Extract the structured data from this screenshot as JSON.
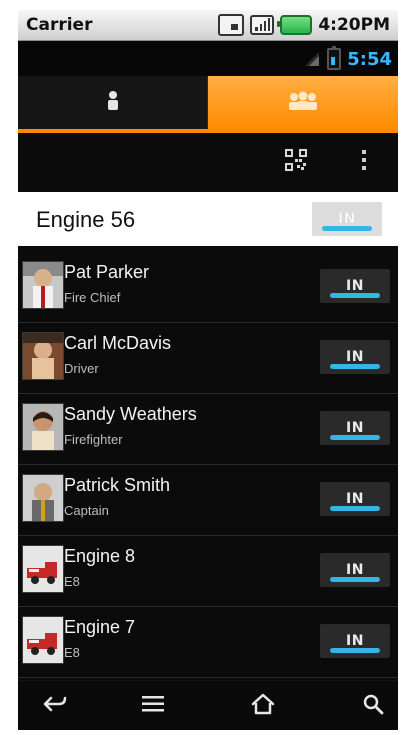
{
  "status_bar": {
    "carrier": "Carrier",
    "time": "4:20PM"
  },
  "android_status": {
    "time": "5:54",
    "accent": "#39b6ff"
  },
  "tabs": [
    {
      "name": "person-tab",
      "selected": false
    },
    {
      "name": "group-tab",
      "selected": true
    }
  ],
  "header_card": {
    "title": "Engine 56",
    "button_label": "IN"
  },
  "members": [
    {
      "name": "Pat Parker",
      "role": "Fire Chief",
      "avatar": "person",
      "status": "IN"
    },
    {
      "name": "Carl McDavis",
      "role": "Driver",
      "avatar": "person",
      "status": "IN"
    },
    {
      "name": "Sandy Weathers",
      "role": "Firefighter",
      "avatar": "person",
      "status": "IN"
    },
    {
      "name": "Patrick Smith",
      "role": "Captain",
      "avatar": "person",
      "status": "IN"
    },
    {
      "name": "Engine 8",
      "role": "E8",
      "avatar": "fire-engine",
      "status": "IN"
    },
    {
      "name": "Engine 7",
      "role": "E8",
      "avatar": "fire-engine",
      "status": "IN"
    }
  ],
  "colors": {
    "tab_active": "#ff8a00",
    "in_bar": "#33b5e5",
    "background": "#0b0b0b"
  },
  "icons": {
    "toolbar": [
      "qr-code-icon",
      "overflow-menu-icon"
    ],
    "bottom_nav": [
      "back-icon",
      "menu-icon",
      "home-icon",
      "search-icon"
    ]
  }
}
